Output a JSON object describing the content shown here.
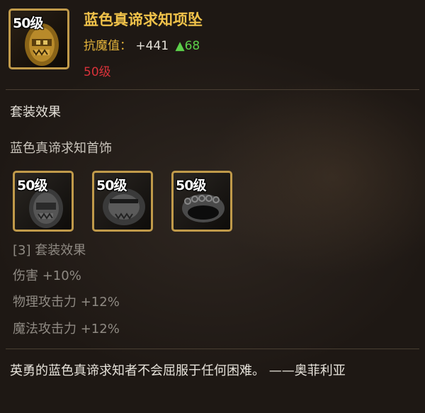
{
  "item": {
    "level_badge": "50级",
    "name": "蓝色真谛求知项坠",
    "stat_label": "抗魔值：",
    "stat_value": "+441",
    "stat_increase": "▲68",
    "required_level": "50级",
    "icon": "necklace-pendant-icon"
  },
  "set": {
    "section_title": "套装效果",
    "name": "蓝色真谛求知首饰",
    "pieces": [
      {
        "level_badge": "50级",
        "icon": "pendant-grey-icon"
      },
      {
        "level_badge": "50级",
        "icon": "bracelet-grey-icon"
      },
      {
        "level_badge": "50级",
        "icon": "ring-grey-icon"
      }
    ],
    "bonus_header": "[3] 套装效果",
    "bonuses": [
      "伤害 +10%",
      "物理攻击力 +12%",
      "魔法攻击力 +12%"
    ]
  },
  "flavor_text": "英勇的蓝色真谛求知者不会屈服于任何困难。 ——奥菲利亚",
  "colors": {
    "item_name": "#f0c24a",
    "stat_label": "#e2b23a",
    "stat_increase": "#5cd04a",
    "required_level": "#d8323a",
    "icon_border": "#c09a4a"
  }
}
